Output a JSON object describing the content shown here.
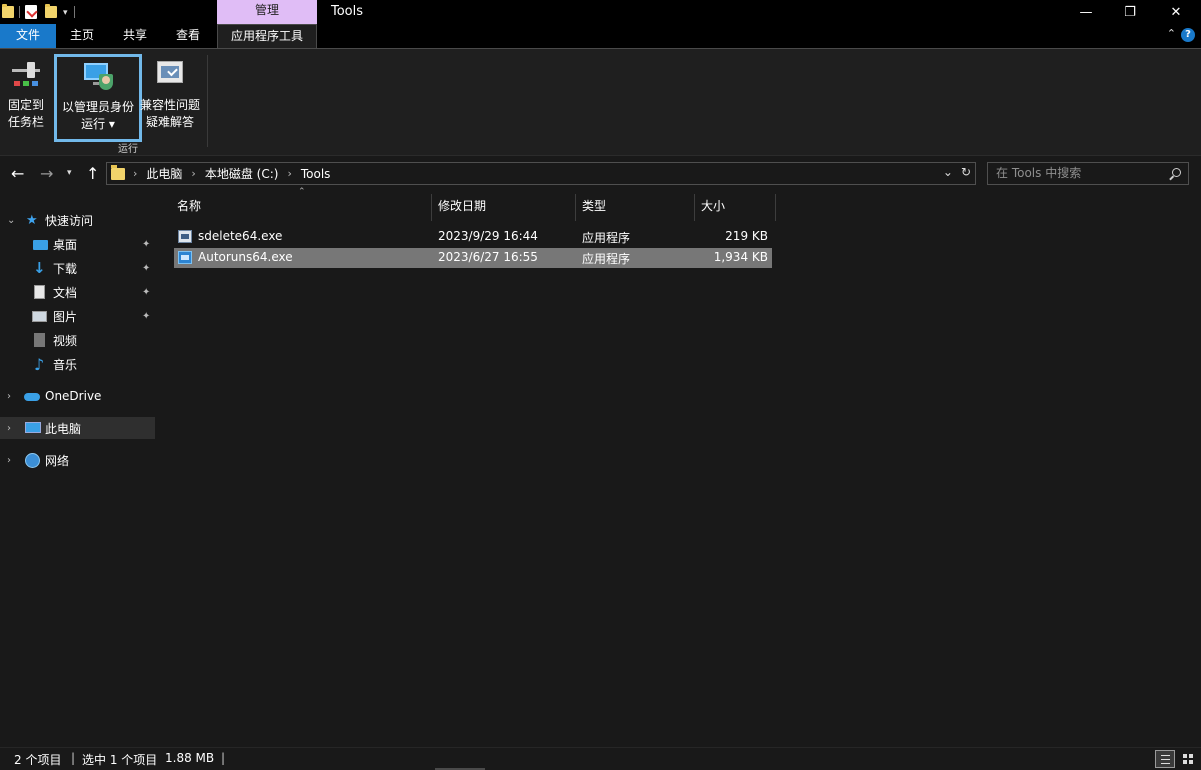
{
  "titlebar": {
    "context_tab": "管理",
    "window_title": "Tools",
    "minimize": "—",
    "maximize": "❐",
    "close": "✕",
    "qat_dropdown": "▾"
  },
  "ribbon_tabs": {
    "file": "文件",
    "home": "主页",
    "share": "共享",
    "view": "查看",
    "app_tools": "应用程序工具",
    "collapse": "⌃",
    "help": "?"
  },
  "ribbon": {
    "pin_line1": "固定到",
    "pin_line2": "任务栏",
    "admin_line1": "以管理员身份",
    "admin_line2": "运行 ▾",
    "compat_line1": "兼容性问题",
    "compat_line2": "疑难解答",
    "group_label": "运行"
  },
  "address": {
    "back": "←",
    "forward": "→",
    "recent": "▾",
    "up": "↑",
    "crumbs": [
      "此电脑",
      "本地磁盘 (C:)",
      "Tools"
    ],
    "crumb_sep": "›",
    "dropdown": "⌄",
    "refresh": "↻",
    "search_placeholder": "在 Tools 中搜索"
  },
  "navpane": {
    "quick_access": "快速访问",
    "desktop": "桌面",
    "downloads": "下载",
    "documents": "文档",
    "pictures": "图片",
    "videos": "视频",
    "music": "音乐",
    "onedrive": "OneDrive",
    "this_pc": "此电脑",
    "network": "网络",
    "expand_open": "⌄",
    "expand_closed": "›",
    "pin": "📌"
  },
  "filelist": {
    "columns": {
      "name": "名称",
      "date": "修改日期",
      "type": "类型",
      "size": "大小"
    },
    "sort_caret": "⌃",
    "rows": [
      {
        "name": "sdelete64.exe",
        "date": "2023/9/29 16:44",
        "type": "应用程序",
        "size": "219 KB"
      },
      {
        "name": "Autoruns64.exe",
        "date": "2023/6/27 16:55",
        "type": "应用程序",
        "size": "1,934 KB"
      }
    ]
  },
  "status": {
    "item_count": "2 个项目",
    "sep": "|",
    "selected": "选中 1 个项目",
    "selected_size": "1.88 MB"
  },
  "colors": {
    "accent": "#1979ca",
    "context_tab": "#e0bdf6",
    "selection_highlight": "#72b9ea",
    "row_selected": "#777777"
  }
}
